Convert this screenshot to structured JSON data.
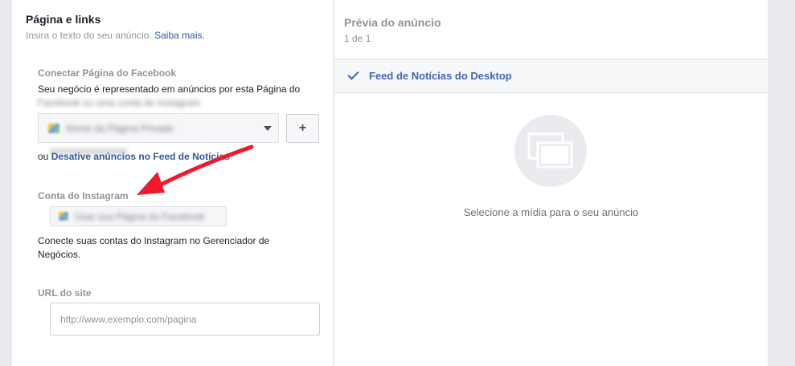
{
  "left": {
    "title": "Página e links",
    "subtitle": "Insira o texto do seu anúncio.",
    "subtitle_link": "Saiba mais.",
    "facebook_page": {
      "label": "Conectar Página do Facebook",
      "desc_line1": "Seu negócio é representado em anúncios por esta Página do",
      "desc_line2_blurred": "Facebook ou uma conta do Instagram",
      "selected_blurred": "Nome da Página Privada",
      "add_button": "+",
      "under_blurred": "xxxxxxxxxxxxxxxx",
      "or_text": "ou",
      "deactivate_link": "Desative anúncios no Feed de Notícias"
    },
    "instagram": {
      "label": "Conta do Instagram",
      "selected_blurred": "Usar sua Página do Facebook",
      "desc": "Conecte suas contas do Instagram no Gerenciador de Negócios."
    },
    "url": {
      "label": "URL do site",
      "placeholder": "http://www.exemplo.com/pagina"
    }
  },
  "right": {
    "title": "Prévia do anúncio",
    "count": "1 de 1",
    "placement": "Feed de Notícias do Desktop",
    "empty_message": "Selecione a mídia para o seu anúncio"
  },
  "icons": {
    "check": "check-icon",
    "caret": "chevron-down-icon",
    "media": "media-placeholder-icon",
    "annotation": "red-arrow-annotation"
  },
  "colors": {
    "link": "#365899",
    "accent": "#4267b2",
    "annotation": "#f0192b"
  }
}
